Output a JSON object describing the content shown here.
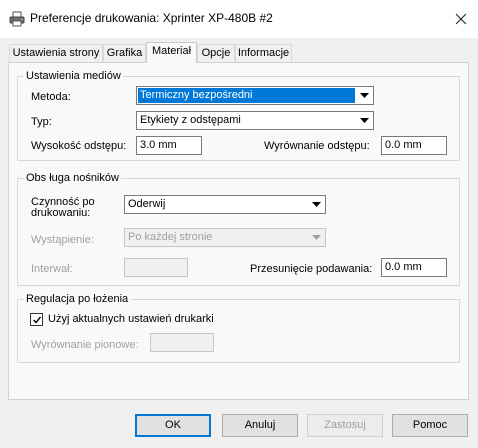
{
  "window": {
    "title": "Preferencje drukowania: Xprinter XP-480B #2"
  },
  "tabs": [
    {
      "label": "Ustawienia strony"
    },
    {
      "label": "Grafika"
    },
    {
      "label": "Materiał"
    },
    {
      "label": "Opcje"
    },
    {
      "label": "Informacje"
    }
  ],
  "active_tab": "Materiał",
  "media_settings": {
    "legend": "Ustawienia mediów",
    "method": {
      "label": "Metoda:",
      "value": "Termiczny bezpośredni"
    },
    "type": {
      "label": "Typ:",
      "value": "Etykiety z odstępami"
    },
    "gap_height": {
      "label": "Wysokość odstępu:",
      "value": "3.0 mm"
    },
    "gap_alignment": {
      "label": "Wyrównanie odstępu:",
      "value": "0.0 mm"
    }
  },
  "media_handling": {
    "legend": "Obs ługa nośników",
    "post_print": {
      "label_line1": "Czynność po",
      "label_line2": "drukowaniu:",
      "value": "Oderwij"
    },
    "occurrence": {
      "label": "Wystąpienie:",
      "value": "Po każdej stronie"
    },
    "interval": {
      "label": "Interwał:",
      "value": ""
    },
    "feed_offset": {
      "label": "Przesunięcie podawania:",
      "value": "0.0 mm"
    }
  },
  "position_adjust": {
    "legend": "Regulacja po łożenia",
    "use_current": {
      "label": "Użyj aktualnych ustawień drukarki",
      "checked": true
    },
    "vertical_alignment": {
      "label": "Wyrównanie pionowe:",
      "value": ""
    }
  },
  "buttons": {
    "ok": "OK",
    "cancel": "Anuluj",
    "apply": "Zastosuj",
    "help": "Pomoc"
  },
  "colors": {
    "selection": "#0078d7",
    "disabled_text": "#a0a0a0"
  },
  "icons": {
    "app": "printer-icon",
    "close": "close-icon",
    "dropdown": "chevron-down-icon",
    "check": "checkmark-icon"
  }
}
